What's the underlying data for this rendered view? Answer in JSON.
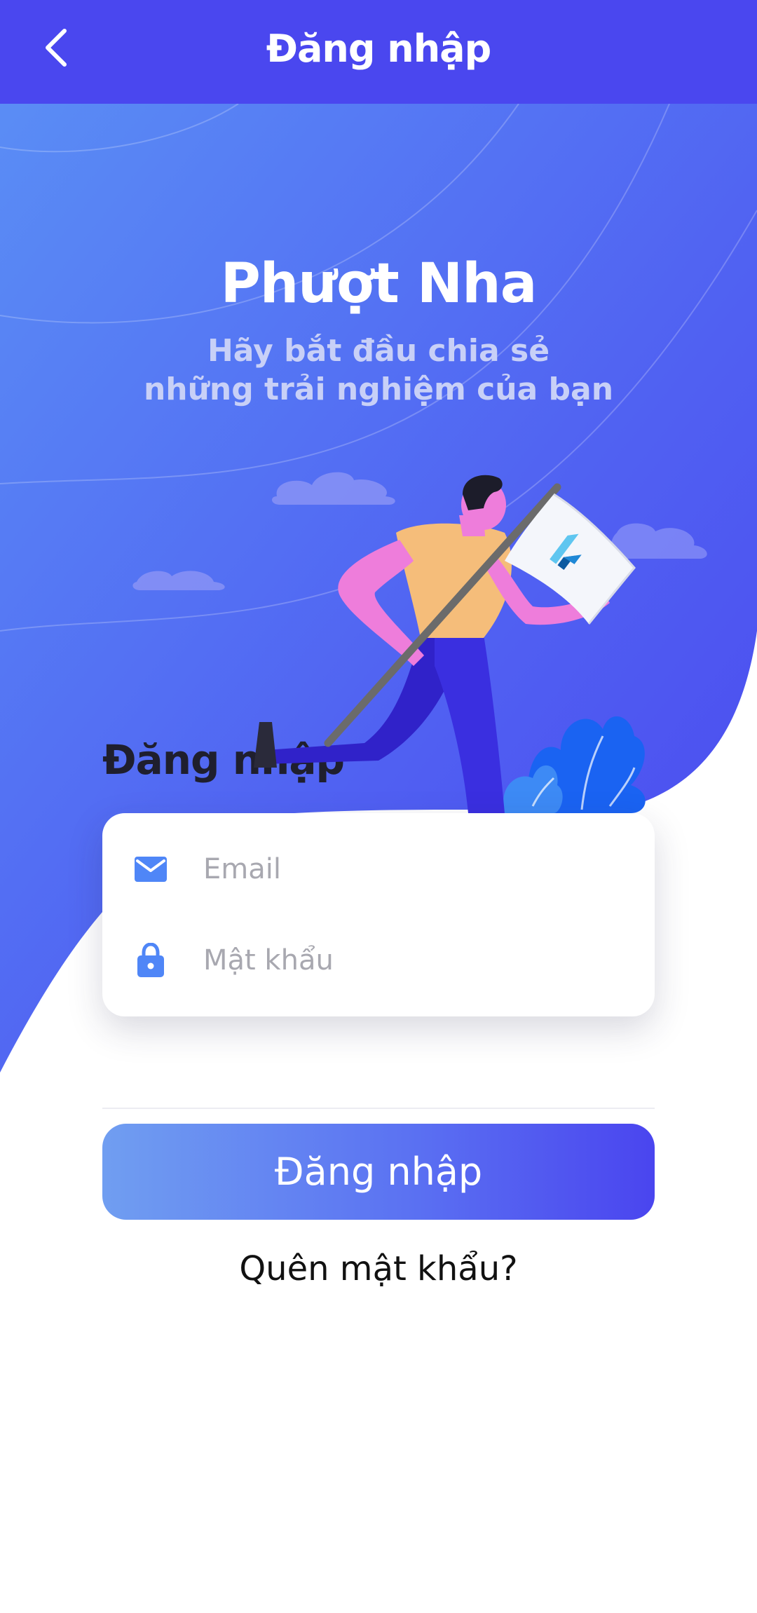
{
  "appbar": {
    "title": "Đăng nhập",
    "back_icon": "chevron-left-icon"
  },
  "hero": {
    "title": "Phượt Nha",
    "subtitle_line1": "Hãy bắt đầu chia sẻ",
    "subtitle_line2": "những trải nghiệm của bạn"
  },
  "form": {
    "section_title": "Đăng nhập",
    "email": {
      "placeholder": "Email",
      "value": "",
      "icon": "mail-icon"
    },
    "password": {
      "placeholder": "Mật khẩu",
      "value": "",
      "icon": "lock-icon"
    },
    "submit_label": "Đăng nhập",
    "forgot_label": "Quên mật khẩu?"
  },
  "colors": {
    "appbar": "#4a47ef",
    "gradient_start": "#5a8ff5",
    "gradient_end": "#4a47ef",
    "accent_icon": "#4f86f7",
    "title_text": "#ffffff",
    "subtitle_text": "#c8d0f7"
  }
}
